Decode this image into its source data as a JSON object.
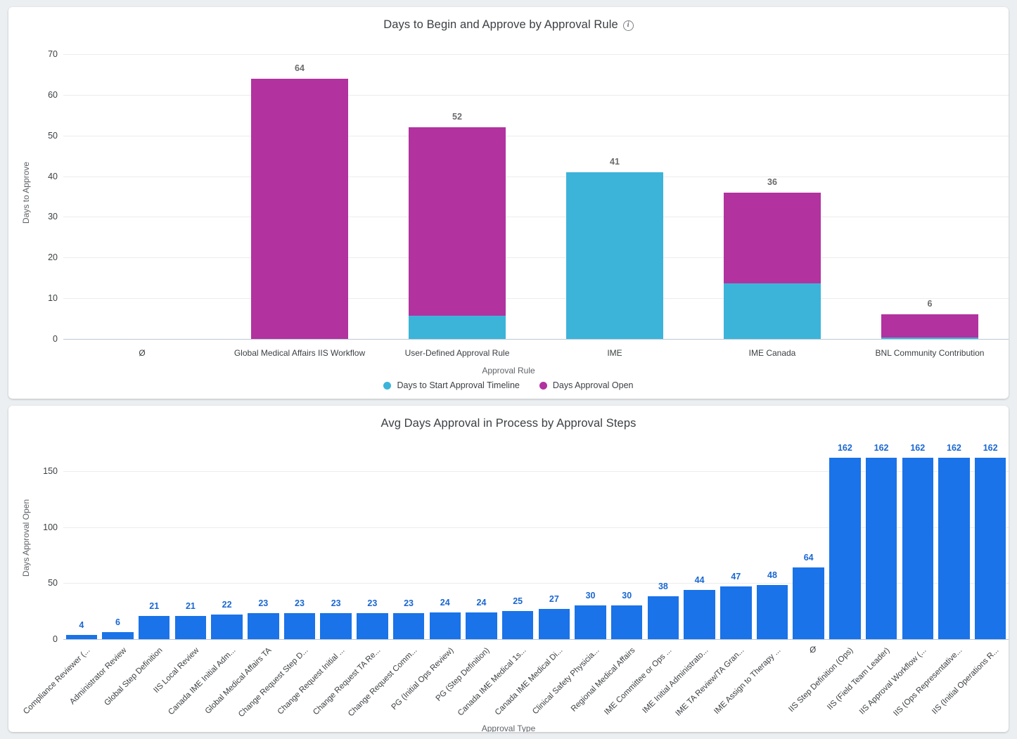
{
  "charts": [
    {
      "id": "approval-rule",
      "title": "Days to Begin and Approve by Approval Rule",
      "info_icon": "info-icon",
      "xlabel": "Approval Rule",
      "ylabel": "Days to Approve",
      "legend": [
        {
          "label": "Days to Start Approval Timeline",
          "color": "#3cb4d9"
        },
        {
          "label": "Days Approval Open",
          "color": "#b2329f"
        }
      ]
    },
    {
      "id": "approval-steps",
      "title": "Avg Days Approval in Process by Approval Steps",
      "xlabel": "Approval Type",
      "ylabel": "Days Approval Open"
    }
  ],
  "chart_data": [
    {
      "type": "bar",
      "stacked": true,
      "title": "Days to Begin and Approve by Approval Rule",
      "xlabel": "Approval Rule",
      "ylabel": "Days to Approve",
      "ylim": [
        0,
        70
      ],
      "yticks": [
        0,
        10,
        20,
        30,
        40,
        50,
        60,
        70
      ],
      "grid": true,
      "legend_position": "bottom",
      "categories": [
        "Ø",
        "Global Medical Affairs IIS Workflow",
        "User-Defined Approval Rule",
        "IME",
        "IME Canada",
        "BNL Community Contribution"
      ],
      "series": [
        {
          "name": "Days to Start Approval Timeline",
          "color": "#3cb4d9",
          "values": [
            0,
            0,
            5.7,
            41,
            13.7,
            0.3
          ]
        },
        {
          "name": "Days Approval Open",
          "color": "#b2329f",
          "values": [
            0,
            64,
            46.3,
            0,
            22.3,
            5.7
          ]
        }
      ],
      "totals": [
        null,
        64,
        52,
        41,
        36,
        6
      ],
      "total_labels": [
        "",
        "64",
        "52",
        "41",
        "36",
        "6"
      ]
    },
    {
      "type": "bar",
      "stacked": false,
      "title": "Avg Days Approval in Process by Approval Steps",
      "xlabel": "Approval Type",
      "ylabel": "Days Approval Open",
      "ylim": [
        0,
        175
      ],
      "yticks": [
        0,
        50,
        100,
        150
      ],
      "grid": true,
      "bar_color": "#1a73e8",
      "label_color": "#1967d2",
      "categories": [
        "Compliance Reviewer (...",
        "Administrator Review",
        "Global Step Definition",
        "IIS Local Review",
        "Canada IME Initial Adm...",
        "Global Medical Affairs TA",
        "Change Request Step D...",
        "Change Request Initial ...",
        "Change Request TA Re...",
        "Change Request Comm...",
        "PG (Initial Ops Review)",
        "PG (Step Definition)",
        "Canada IME Medical 1s...",
        "Canada IME Medical Di...",
        "Clinical Safety Physicia...",
        "Regional Medical Affairs",
        "IME Committee or Ops ...",
        "IME Initial Administrato...",
        "IME TA Review/TA Gran...",
        "IME Assign to Therapy ...",
        "Ø",
        "IIS Step Definition (Ops)",
        "IIS (Field Team Leader)",
        "IIS Approval Workflow (...",
        "IIS (Ops Representative...",
        "IIS (Initial Operations R..."
      ],
      "values": [
        4,
        6,
        21,
        21,
        22,
        23,
        23,
        23,
        23,
        23,
        24,
        24,
        25,
        27,
        30,
        30,
        38,
        44,
        47,
        48,
        64,
        162,
        162,
        162,
        162,
        162
      ],
      "value_labels": [
        "4",
        "6",
        "21",
        "21",
        "22",
        "23",
        "23",
        "23",
        "23",
        "23",
        "24",
        "24",
        "25",
        "27",
        "30",
        "30",
        "38",
        "44",
        "47",
        "48",
        "64",
        "162",
        "162",
        "162",
        "162",
        "162"
      ]
    }
  ]
}
